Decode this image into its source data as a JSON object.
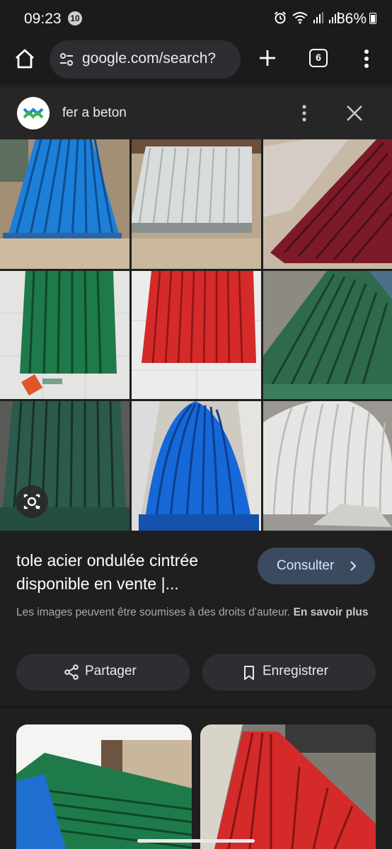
{
  "status_bar": {
    "time": "09:23",
    "notification_count": "10",
    "battery_percent": "86%"
  },
  "browser": {
    "url": "google.com/search?",
    "tab_count": "6"
  },
  "lens_header": {
    "query": "fer a beton"
  },
  "grid": {
    "images": [
      {
        "name": "blue-sheets",
        "color": "#1e7fd8"
      },
      {
        "name": "white-sheets",
        "color": "#d9dcdc"
      },
      {
        "name": "maroon-sheets",
        "color": "#7d1a2a"
      },
      {
        "name": "green-sheets",
        "color": "#1f7a4a"
      },
      {
        "name": "red-sheets",
        "color": "#d42a2a"
      },
      {
        "name": "dark-green-sheets",
        "color": "#2e6b4d"
      },
      {
        "name": "teal-sheets",
        "color": "#2c5a4c"
      },
      {
        "name": "blue-curved-sheets",
        "color": "#1667d8"
      },
      {
        "name": "white-curved-sheets",
        "color": "#e5e6e3"
      }
    ]
  },
  "result": {
    "title": "tole acier ondulée cintrée disponible en vente |...",
    "consult_label": "Consulter",
    "copyright_text": "Les images peuvent être soumises à des droits d'auteur.",
    "learn_more": "En savoir plus"
  },
  "actions": {
    "share_label": "Partager",
    "save_label": "Enregistrer"
  },
  "colors": {
    "background": "#1f1f1f",
    "consult_button": "#3b4a5e",
    "pill": "#2d2e31"
  }
}
